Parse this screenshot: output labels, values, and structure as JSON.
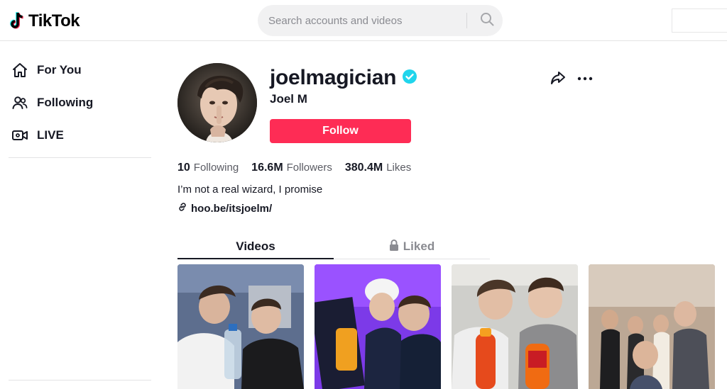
{
  "header": {
    "logo_text": "TikTok",
    "search_placeholder": "Search accounts and videos"
  },
  "sidebar": {
    "items": [
      {
        "label": "For You",
        "icon": "home-icon"
      },
      {
        "label": "Following",
        "icon": "users-icon"
      },
      {
        "label": "LIVE",
        "icon": "live-video-icon"
      }
    ]
  },
  "profile": {
    "username": "joelmagician",
    "verified": true,
    "display_name": "Joel M",
    "follow_label": "Follow",
    "stats": [
      {
        "value": "10",
        "label": "Following"
      },
      {
        "value": "16.6M",
        "label": "Followers"
      },
      {
        "value": "380.4M",
        "label": "Likes"
      }
    ],
    "bio": "I’m not a real wizard, I promise",
    "link": "hoo.be/itsjoelm/"
  },
  "tabs": [
    {
      "label": "Videos",
      "active": true
    },
    {
      "label": "Liked",
      "active": false,
      "icon": "lock-icon"
    }
  ],
  "colors": {
    "accent": "#fe2c55",
    "verified": "#20d5ec",
    "text": "#161823",
    "muted": "#8a8b91"
  },
  "videos": [
    {
      "thumbnail": "two boys with water bottle"
    },
    {
      "thumbnail": "two boys with box, purple light"
    },
    {
      "thumbnail": "two boys with orange bottles"
    },
    {
      "thumbnail": "group at party"
    }
  ]
}
